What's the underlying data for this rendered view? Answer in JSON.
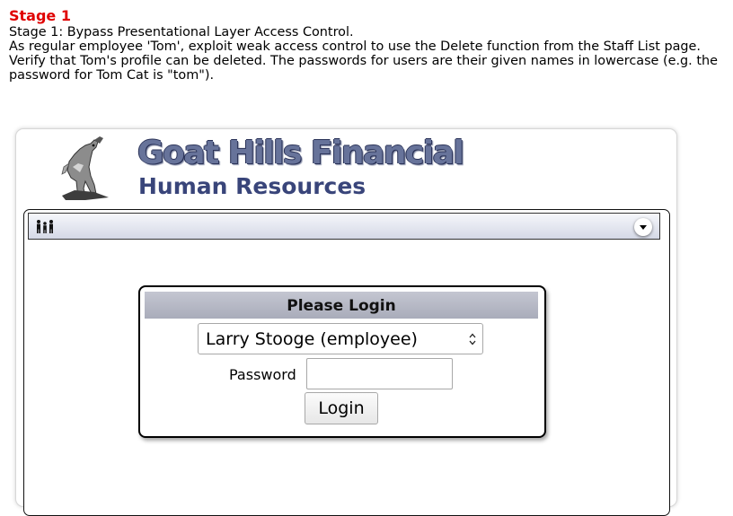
{
  "lesson": {
    "stage_title": "Stage 1",
    "instructions": [
      "Stage 1: Bypass Presentational Layer Access Control.",
      "As regular employee 'Tom', exploit weak access control to use the Delete function from the Staff List page. Verify that Tom's profile can be deleted. The passwords for users are their given names in lowercase (e.g. the password for Tom Cat is \"tom\")."
    ]
  },
  "header": {
    "company": "Goat Hills Financial",
    "department": "Human Resources",
    "logo_icon": "goat-logo-icon"
  },
  "toolbar": {
    "left_icon": "people-icon",
    "right_icon": "dropdown-toggle-icon"
  },
  "login": {
    "header": "Please Login",
    "selected_user": "Larry Stooge (employee)",
    "password_label": "Password",
    "password_value": "",
    "button_label": "Login"
  },
  "colors": {
    "stage_title": "#e00000",
    "company_text": "#67739a",
    "department_text": "#39457a",
    "login_header_bg": "#b4b6c3"
  }
}
